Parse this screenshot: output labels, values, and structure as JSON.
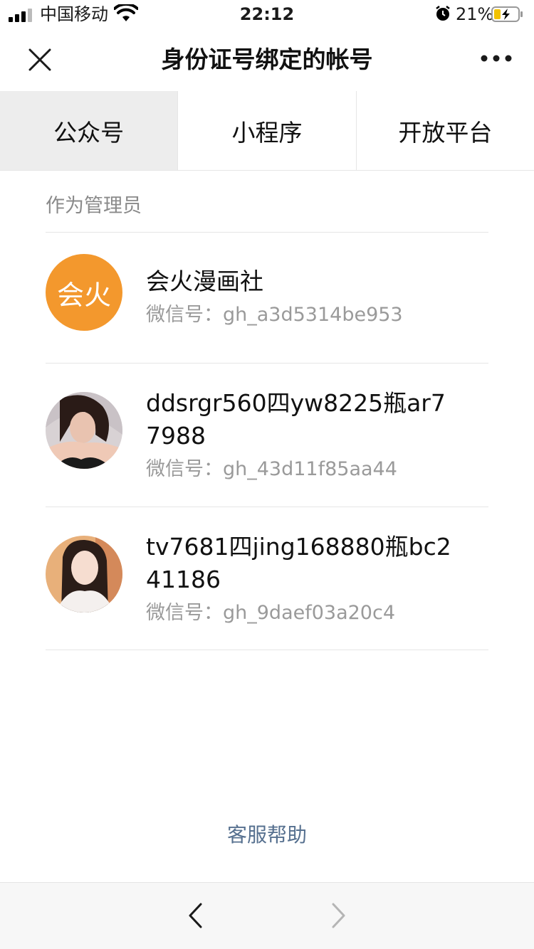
{
  "status_bar": {
    "carrier": "中国移动",
    "time": "22:12",
    "battery_percent": "21%",
    "icons": [
      "signal-icon",
      "wifi-icon",
      "alarm-icon",
      "battery-charging-icon"
    ]
  },
  "nav": {
    "title": "身份证号绑定的帐号",
    "icons": [
      "close-icon",
      "more-icon"
    ]
  },
  "tabs": [
    {
      "label": "公众号",
      "active": true
    },
    {
      "label": "小程序",
      "active": false
    },
    {
      "label": "开放平台",
      "active": false
    }
  ],
  "section": {
    "label": "作为管理员"
  },
  "accounts": [
    {
      "name": "会火漫画社",
      "avatar_text": "会火",
      "wechat_id": "微信号：gh_a3d5314be953",
      "avatar_color": "#f3982d"
    },
    {
      "name": "ddsrgr560四yw8225瓶ar77988",
      "wechat_id": "微信号：gh_43d11f85aa44"
    },
    {
      "name": "tv7681四jing168880瓶bc241186",
      "wechat_id": "微信号：gh_9daef03a20c4"
    }
  ],
  "footer": {
    "help_label": "客服帮助"
  },
  "toolbar": {
    "icons": [
      "back-icon",
      "forward-icon"
    ]
  },
  "colors": {
    "link": "#56708f",
    "active_tab_bg": "#ededed",
    "secondary_text": "#9a9a9a"
  }
}
